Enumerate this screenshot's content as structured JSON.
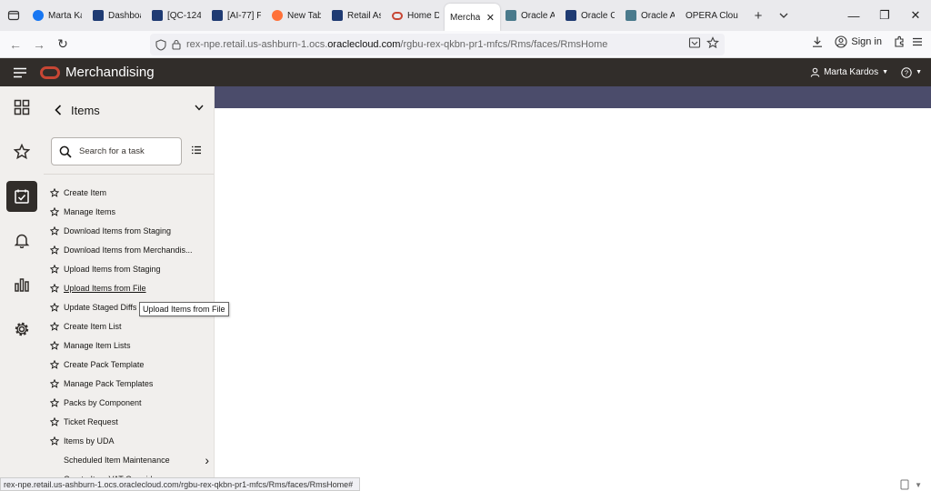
{
  "browser": {
    "tabs": [
      {
        "label": "Marta Ka",
        "favicon": "facebook-icon",
        "color": "#1877f2"
      },
      {
        "label": "Dashboa",
        "favicon": "jira-doc-icon",
        "color": "#1f3b73"
      },
      {
        "label": "[QC-124",
        "favicon": "jira-doc-icon",
        "color": "#1f3b73"
      },
      {
        "label": "[AI-77] F",
        "favicon": "jira-doc-icon",
        "color": "#1f3b73"
      },
      {
        "label": "New Tab",
        "favicon": "firefox-icon",
        "color": "#ff7139"
      },
      {
        "label": "Retail As",
        "favicon": "retail-icon",
        "color": "#1f3b73"
      },
      {
        "label": "Home D",
        "favicon": "oracle-icon",
        "color": "#c74634"
      },
      {
        "label": "Merchanc",
        "favicon": "",
        "color": "#ffffff",
        "active": true
      },
      {
        "label": "Oracle A",
        "favicon": "oracle-apex-icon",
        "color": "#4a7a8c"
      },
      {
        "label": "Oracle C",
        "favicon": "jira-doc-icon",
        "color": "#1f3b73"
      },
      {
        "label": "Oracle A",
        "favicon": "oracle-apex-icon",
        "color": "#4a7a8c"
      },
      {
        "label": "OPERA Clou",
        "favicon": "",
        "color": "#ffffff"
      }
    ],
    "url": {
      "prefix": "rex-npe.retail.us-ashburn-1.ocs.",
      "domain": "oraclecloud.com",
      "path": "/rgbu-rex-qkbn-pr1-mfcs/Rms/faces/RmsHome"
    },
    "signin_label": "Sign in",
    "status_url": "rex-npe.retail.us-ashburn-1.ocs.oraclecloud.com/rgbu-rex-qkbn-pr1-mfcs/Rms/faces/RmsHome#"
  },
  "app": {
    "title": "Merchandising",
    "user_name": "Marta Kardos",
    "brand_color": "#c74634",
    "header_color": "#312d2a",
    "banner_color": "#4b4c6b"
  },
  "rail": {
    "items": [
      {
        "icon": "grid-icon"
      },
      {
        "icon": "star-icon"
      },
      {
        "icon": "tasks-icon",
        "active": true
      },
      {
        "icon": "bell-icon"
      },
      {
        "icon": "bar-chart-icon"
      },
      {
        "icon": "gear-icon"
      }
    ]
  },
  "panel": {
    "title": "Items",
    "search_placeholder": "Search for a task",
    "tasks": [
      {
        "label": "Create Item"
      },
      {
        "label": "Manage Items"
      },
      {
        "label": "Download Items from Staging"
      },
      {
        "label": "Download Items from Merchandis..."
      },
      {
        "label": "Upload Items from Staging"
      },
      {
        "label": "Upload Items from File",
        "hover": true
      },
      {
        "label": "Update Staged Diffs"
      },
      {
        "label": "Create Item List"
      },
      {
        "label": "Manage Item Lists"
      },
      {
        "label": "Create Pack Template"
      },
      {
        "label": "Manage Pack Templates"
      },
      {
        "label": "Packs by Component"
      },
      {
        "label": "Ticket Request"
      },
      {
        "label": "Items by UDA"
      },
      {
        "label": "Scheduled Item Maintenance",
        "submenu": true
      },
      {
        "label": "Create Item VAT Overrides",
        "submenu": true
      }
    ]
  },
  "tooltip": {
    "text": "Upload Items from File"
  }
}
